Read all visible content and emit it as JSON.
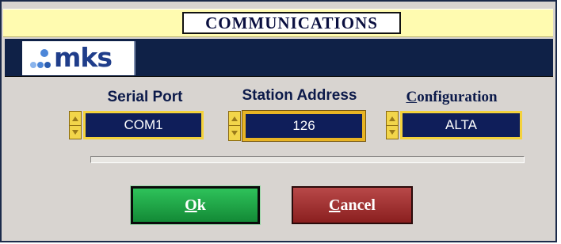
{
  "window": {
    "title": "COMMUNICATIONS"
  },
  "brand": {
    "logo_text": "mks"
  },
  "fields": {
    "serial_port": {
      "label": "Serial Port",
      "value": "COM1"
    },
    "station_address": {
      "label": "Station Address",
      "value": "126"
    },
    "configuration": {
      "label_mnemonic": "C",
      "label_rest": "onfiguration",
      "value": "ALTA"
    }
  },
  "progress": {
    "fraction": 0
  },
  "buttons": {
    "ok": {
      "mnemonic": "O",
      "rest": "k"
    },
    "cancel": {
      "mnemonic": "C",
      "rest": "ancel"
    }
  },
  "colors": {
    "title_bg": "#fffbb0",
    "brand_bar": "#0f2147",
    "field_bg": "#0f1e5a",
    "field_border": "#f4d23c",
    "ok_button": "#1fa94a",
    "cancel_button": "#a03434"
  }
}
